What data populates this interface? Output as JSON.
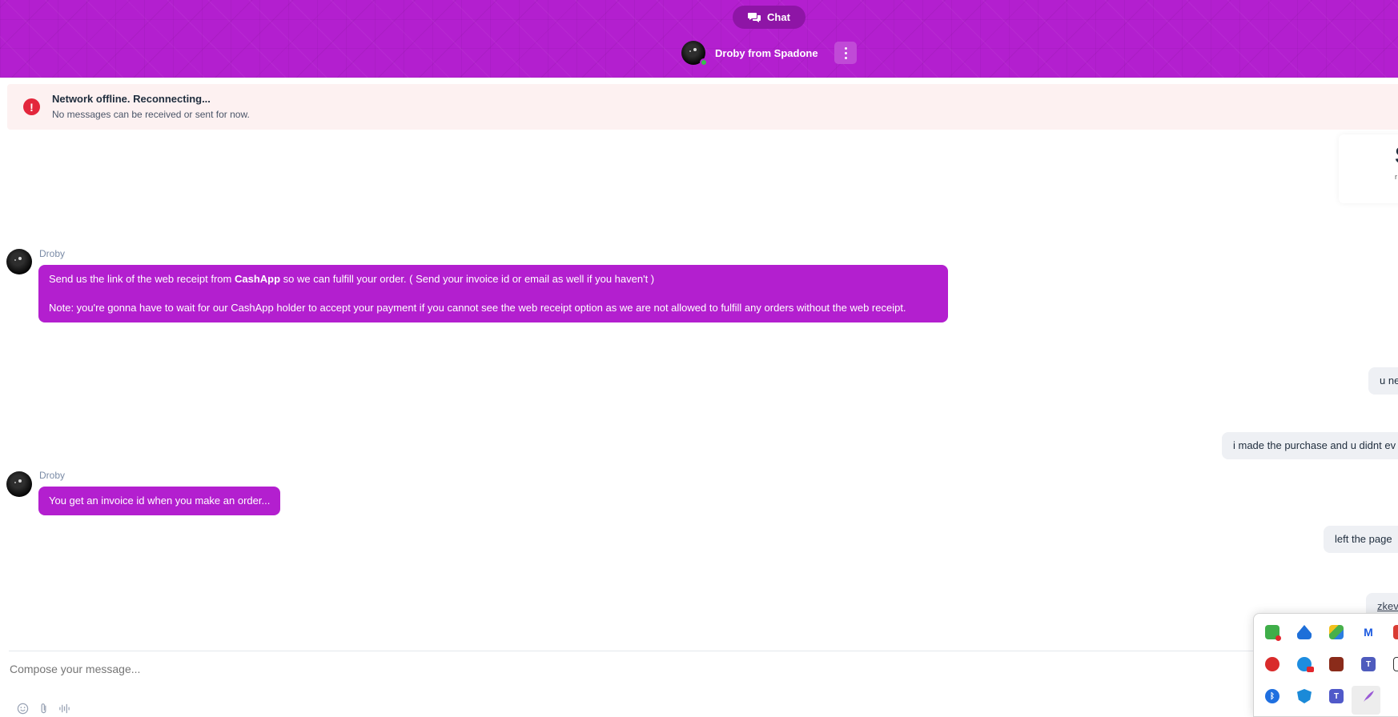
{
  "header": {
    "chat_label": "Chat",
    "agent_name": "Droby from Spadone",
    "brand_color": "#b31fcf"
  },
  "banner": {
    "title": "Network offline. Reconnecting...",
    "subtitle": "No messages can be received or sent for now."
  },
  "side_card": {
    "big_text": "S",
    "small_text": "r"
  },
  "messages": [
    {
      "sender": "Droby",
      "line1_pre": "Send us the link of the web receipt from ",
      "line1_bold": "CashApp",
      "line1_post": " so we can fulfill your order. ( Send your invoice id or email as well if you haven't )",
      "line2": "Note: you're gonna have to wait for our CashApp holder to accept your payment if you cannot see the web receipt option as we are not allowed to fulfill any orders without the web receipt."
    },
    {
      "text": "u ne"
    },
    {
      "text": "i made the purchase and u didnt ev"
    },
    {
      "sender": "Droby",
      "text": "You get an invoice id when you make an order..."
    },
    {
      "text": "left the page"
    },
    {
      "text": "zkev"
    }
  ],
  "composer": {
    "placeholder": "Compose your message..."
  },
  "toolbar_icons": [
    "emoji-icon",
    "attachment-icon",
    "voice-icon"
  ],
  "tray_icons": [
    "security-check-icon",
    "upload-icon",
    "bluestacks-icon",
    "malwarebytes-icon",
    "red-app-icon",
    "message-app-icon",
    "red-badge-app-icon",
    "game-app-icon",
    "teams-icon",
    "window-icon",
    "bluetooth-icon",
    "defender-warning-icon",
    "teams-classic-icon",
    "feather-icon"
  ]
}
